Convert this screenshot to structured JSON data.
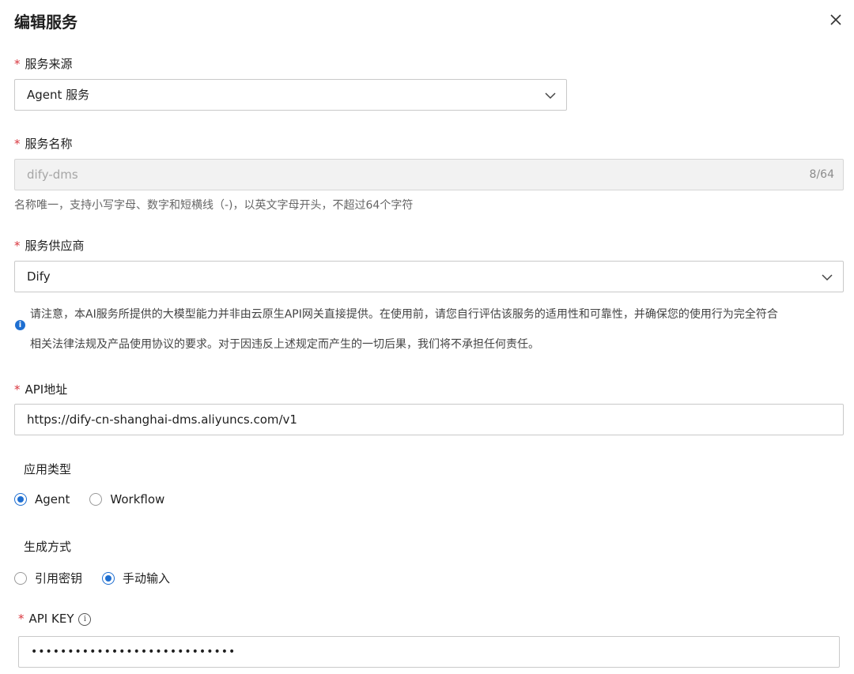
{
  "dialog": {
    "title": "编辑服务"
  },
  "service_source": {
    "label": "服务来源",
    "value": "Agent 服务"
  },
  "service_name": {
    "label": "服务名称",
    "value": "dify-dms",
    "counter": "8/64",
    "help": "名称唯一，支持小写字母、数字和短横线（-)，以英文字母开头，不超过64个字符"
  },
  "provider": {
    "label": "服务供应商",
    "value": "Dify",
    "notice_line1": "请注意，本AI服务所提供的大模型能力并非由云原生API网关直接提供。在使用前，请您自行评估该服务的适用性和可靠性，并确保您的使用行为完全符合",
    "notice_line2": "相关法律法规及产品使用协议的要求。对于因违反上述规定而产生的一切后果，我们将不承担任何责任。"
  },
  "api_url": {
    "label": "API地址",
    "value": "https://dify-cn-shanghai-dms.aliyuncs.com/v1"
  },
  "app_type": {
    "label": "应用类型",
    "options": [
      "Agent",
      "Workflow"
    ],
    "selected": "Agent"
  },
  "gen_mode": {
    "label": "生成方式",
    "options": [
      "引用密钥",
      "手动输入"
    ],
    "selected": "手动输入"
  },
  "api_key": {
    "label": "API KEY",
    "masked_value": "••••••••••••••••••••••••••••"
  },
  "colors": {
    "accent": "#1f6fd1",
    "required": "#d9363e"
  },
  "icons": {
    "close": "close-icon",
    "chevron": "chevron-down-icon",
    "info": "info-icon"
  }
}
